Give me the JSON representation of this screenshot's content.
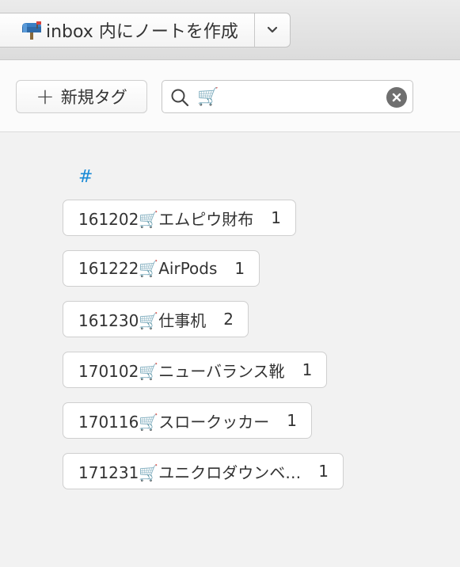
{
  "header": {
    "new_note_label": "inbox 内にノートを作成",
    "icons": {
      "mailbox": "mailbox-icon",
      "dropdown": "chevron-down-icon"
    }
  },
  "toolbar": {
    "new_tag_label": "新規タグ",
    "search": {
      "value": "🛒",
      "icon": "search-icon",
      "clear_icon": "clear-icon"
    }
  },
  "tags": {
    "heading": "#",
    "items": [
      {
        "name": "161202🛒エムピウ財布",
        "count": "1"
      },
      {
        "name": "161222🛒AirPods",
        "count": "1"
      },
      {
        "name": "161230🛒仕事机",
        "count": "2"
      },
      {
        "name": "170102🛒ニューバランス靴",
        "count": "1"
      },
      {
        "name": "170116🛒スロークッカー",
        "count": "1"
      },
      {
        "name": "171231🛒ユニクロダウンベ…",
        "count": "1"
      }
    ]
  },
  "colors": {
    "accent": "#1a8ad6",
    "mailbox_blue": "#3a7fc4",
    "mailbox_red": "#d8433b"
  }
}
